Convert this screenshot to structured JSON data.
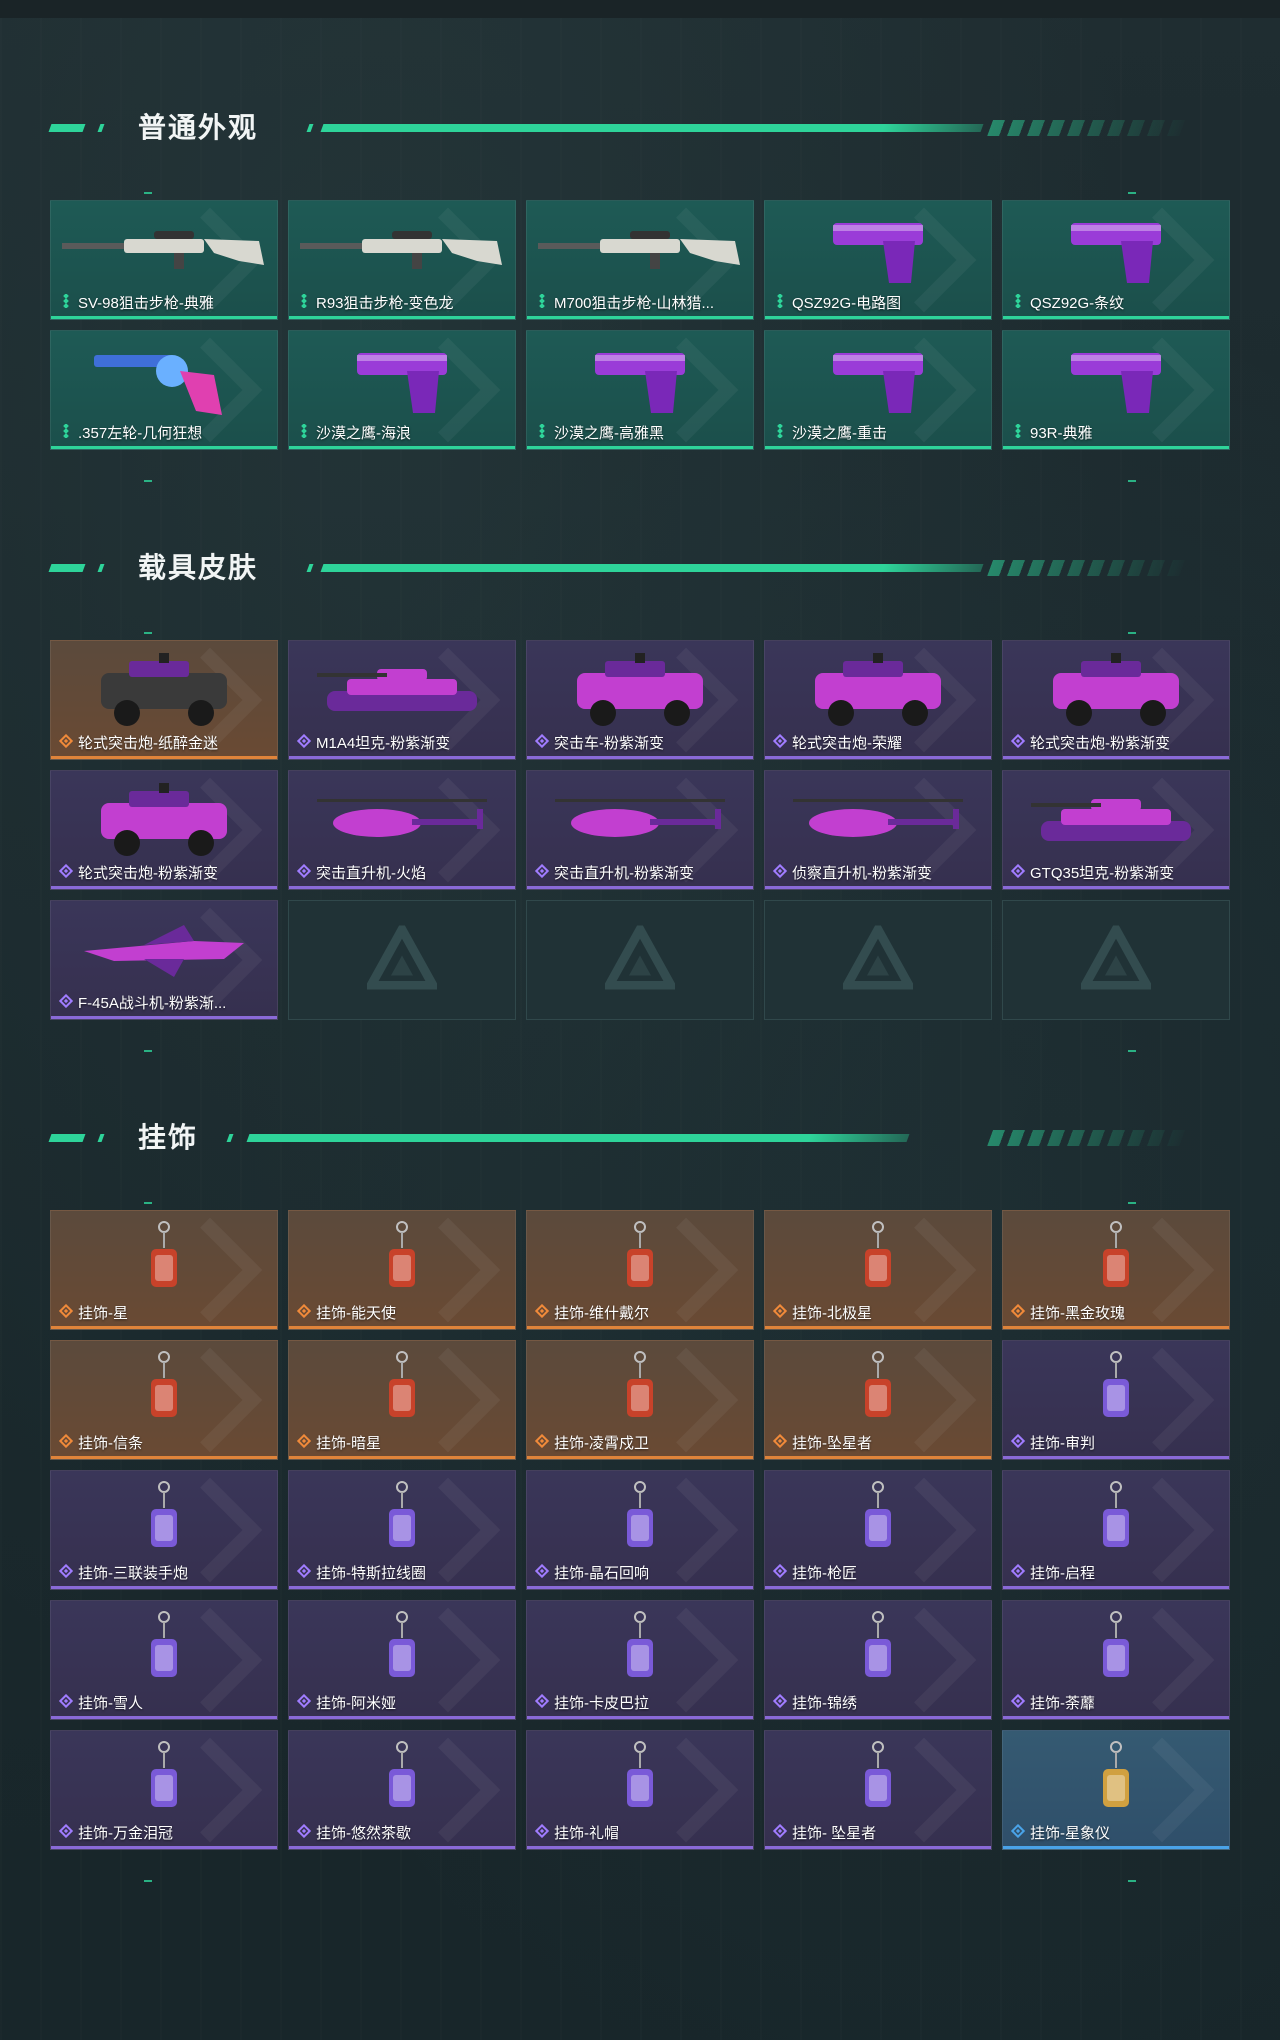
{
  "colors": {
    "accent": "#2ed49a",
    "tier_teal": "#1e5a55",
    "tier_purple": "#3a3659",
    "tier_orange": "#6a4a33",
    "tier_blue": "#355a72"
  },
  "sections": [
    {
      "title": "普通外观",
      "items": [
        {
          "label": "SV-98狙击步枪-典雅",
          "tier": "teal",
          "icon": "rifle-icon"
        },
        {
          "label": "R93狙击步枪-变色龙",
          "tier": "teal",
          "icon": "rifle-icon"
        },
        {
          "label": "M700狙击步枪-山林猎...",
          "tier": "teal",
          "icon": "rifle-icon"
        },
        {
          "label": "QSZ92G-电路图",
          "tier": "teal",
          "icon": "pistol-icon"
        },
        {
          "label": "QSZ92G-条纹",
          "tier": "teal",
          "icon": "pistol-icon"
        },
        {
          "label": ".357左轮-几何狂想",
          "tier": "teal",
          "icon": "revolver-icon"
        },
        {
          "label": "沙漠之鹰-海浪",
          "tier": "teal",
          "icon": "pistol-icon"
        },
        {
          "label": "沙漠之鹰-高雅黑",
          "tier": "teal",
          "icon": "pistol-icon"
        },
        {
          "label": "沙漠之鹰-重击",
          "tier": "teal",
          "icon": "pistol-icon"
        },
        {
          "label": "93R-典雅",
          "tier": "teal",
          "icon": "pistol-icon"
        }
      ]
    },
    {
      "title": "载具皮肤",
      "items": [
        {
          "label": "轮式突击炮-纸醉金迷",
          "tier": "orange",
          "icon": "armored-vehicle-icon"
        },
        {
          "label": "M1A4坦克-粉紫渐变",
          "tier": "purple",
          "icon": "tank-icon"
        },
        {
          "label": "突击车-粉紫渐变",
          "tier": "purple",
          "icon": "armored-vehicle-icon"
        },
        {
          "label": "轮式突击炮-荣耀",
          "tier": "purple",
          "icon": "armored-vehicle-icon"
        },
        {
          "label": "轮式突击炮-粉紫渐变",
          "tier": "purple",
          "icon": "armored-vehicle-icon"
        },
        {
          "label": "轮式突击炮-粉紫渐变",
          "tier": "purple",
          "icon": "armored-vehicle-icon"
        },
        {
          "label": "突击直升机-火焰",
          "tier": "purple",
          "icon": "helicopter-icon"
        },
        {
          "label": "突击直升机-粉紫渐变",
          "tier": "purple",
          "icon": "helicopter-icon"
        },
        {
          "label": "侦察直升机-粉紫渐变",
          "tier": "purple",
          "icon": "helicopter-icon"
        },
        {
          "label": "GTQ35坦克-粉紫渐变",
          "tier": "purple",
          "icon": "tank-icon"
        },
        {
          "label": "F-45A战斗机-粉紫渐...",
          "tier": "purple",
          "icon": "jet-icon"
        },
        {
          "label": "",
          "tier": "empty",
          "icon": "placeholder-logo-icon"
        },
        {
          "label": "",
          "tier": "empty",
          "icon": "placeholder-logo-icon"
        },
        {
          "label": "",
          "tier": "empty",
          "icon": "placeholder-logo-icon"
        },
        {
          "label": "",
          "tier": "empty",
          "icon": "placeholder-logo-icon"
        }
      ]
    },
    {
      "title": "挂饰",
      "items": [
        {
          "label": "挂饰-星",
          "tier": "orange",
          "icon": "charm-icon"
        },
        {
          "label": "挂饰-能天使",
          "tier": "orange",
          "icon": "charm-icon"
        },
        {
          "label": "挂饰-维什戴尔",
          "tier": "orange",
          "icon": "charm-icon"
        },
        {
          "label": "挂饰-北极星",
          "tier": "orange",
          "icon": "charm-icon"
        },
        {
          "label": "挂饰-黑金玫瑰",
          "tier": "orange",
          "icon": "charm-icon"
        },
        {
          "label": "挂饰-信条",
          "tier": "orange",
          "icon": "charm-icon"
        },
        {
          "label": "挂饰-暗星",
          "tier": "orange",
          "icon": "charm-icon"
        },
        {
          "label": "挂饰-凌霄戍卫",
          "tier": "orange",
          "icon": "charm-icon"
        },
        {
          "label": "挂饰-坠星者",
          "tier": "orange",
          "icon": "charm-icon"
        },
        {
          "label": "挂饰-审判",
          "tier": "purple",
          "icon": "charm-icon"
        },
        {
          "label": "挂饰-三联装手炮",
          "tier": "purple",
          "icon": "charm-icon"
        },
        {
          "label": "挂饰-特斯拉线圈",
          "tier": "purple",
          "icon": "charm-icon"
        },
        {
          "label": "挂饰-晶石回响",
          "tier": "purple",
          "icon": "charm-icon"
        },
        {
          "label": "挂饰-枪匠",
          "tier": "purple",
          "icon": "charm-icon"
        },
        {
          "label": "挂饰-启程",
          "tier": "purple",
          "icon": "charm-icon"
        },
        {
          "label": "挂饰-雪人",
          "tier": "purple",
          "icon": "charm-icon"
        },
        {
          "label": "挂饰-阿米娅",
          "tier": "purple",
          "icon": "charm-icon"
        },
        {
          "label": "挂饰-卡皮巴拉",
          "tier": "purple",
          "icon": "charm-icon"
        },
        {
          "label": "挂饰-锦绣",
          "tier": "purple",
          "icon": "charm-icon"
        },
        {
          "label": "挂饰-荼蘼",
          "tier": "purple",
          "icon": "charm-icon"
        },
        {
          "label": "挂饰-万金泪冠",
          "tier": "purple",
          "icon": "charm-icon"
        },
        {
          "label": "挂饰-悠然茶歇",
          "tier": "purple",
          "icon": "charm-icon"
        },
        {
          "label": "挂饰-礼帽",
          "tier": "purple",
          "icon": "charm-icon"
        },
        {
          "label": "挂饰- 坠星者",
          "tier": "purple",
          "icon": "charm-icon"
        },
        {
          "label": "挂饰-星象仪",
          "tier": "blue",
          "icon": "charm-icon"
        }
      ]
    }
  ]
}
